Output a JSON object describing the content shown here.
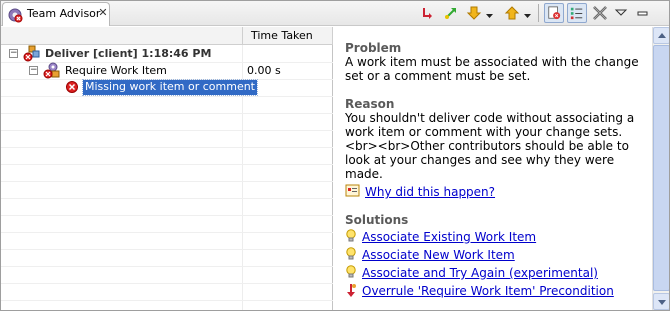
{
  "tab": {
    "title": "Team Advisor",
    "close_glyph": "✕",
    "icon": "team-advisor-icon"
  },
  "toolbar": {
    "buttons": [
      {
        "name": "rerun-icon"
      },
      {
        "name": "run-icon"
      },
      {
        "name": "next-down-icon"
      },
      {
        "name": "previous-up-icon"
      },
      {
        "name": "filter-errors-icon"
      },
      {
        "name": "show-list-icon"
      },
      {
        "name": "remove-all-icon"
      },
      {
        "name": "view-menu-icon"
      }
    ]
  },
  "table": {
    "columns": [
      "",
      "Time Taken"
    ],
    "rows": [
      {
        "label": "Deliver [client] 1:18:46 PM",
        "time": "",
        "icon": "deliver-error-icon"
      },
      {
        "label": "Require Work Item",
        "time": "0.00 s",
        "icon": "precondition-error-icon"
      },
      {
        "label": "Missing work item or comment",
        "time": "",
        "icon": "error-icon"
      }
    ]
  },
  "detail": {
    "problem_heading": "Problem",
    "problem_text": "A work item must be associated with the change set or a comment must be set.",
    "reason_heading": "Reason",
    "reason_text": "You shouldn't deliver code without associating a work item or comment with your change sets.<br><br>Other contributors should be able to look at your changes and see why they were made.",
    "why_link": "Why did this happen?",
    "solutions_heading": "Solutions",
    "solutions": [
      {
        "label": "Associate Existing Work Item",
        "icon": "lightbulb-icon"
      },
      {
        "label": "Associate New Work Item",
        "icon": "lightbulb-icon"
      },
      {
        "label": "Associate and Try Again (experimental)",
        "icon": "lightbulb-icon"
      },
      {
        "label": "Overrule 'Require Work Item' Precondition",
        "icon": "overrule-icon"
      }
    ]
  }
}
